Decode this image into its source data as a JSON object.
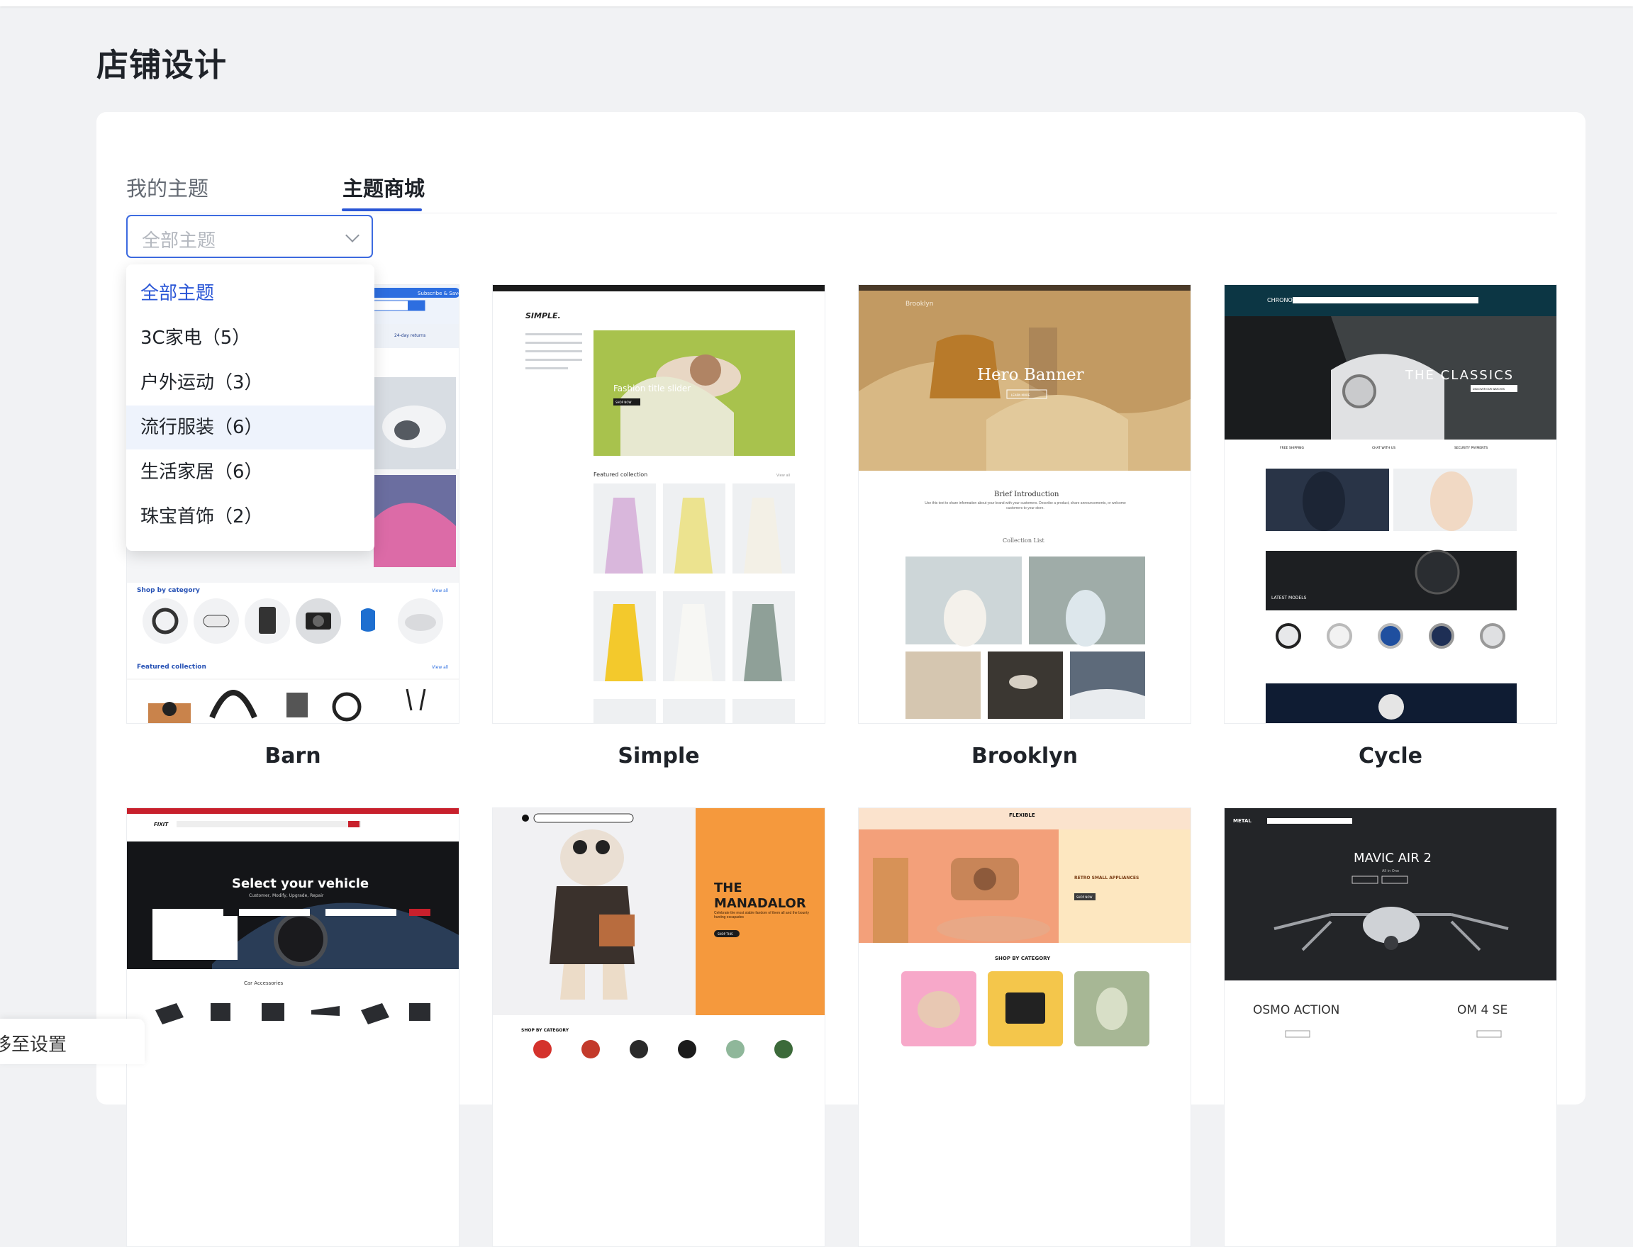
{
  "page": {
    "title": "店铺设计"
  },
  "tabs": [
    {
      "label": "我的主题",
      "active": false
    },
    {
      "label": "主题商城",
      "active": true
    }
  ],
  "filter": {
    "placeholder": "全部主题",
    "options": [
      {
        "label": "全部主题",
        "selected": true
      },
      {
        "label": "3C家电（5）"
      },
      {
        "label": "户外运动（3）"
      },
      {
        "label": "流行服装（6）",
        "hovered": true
      },
      {
        "label": "生活家居（6）"
      },
      {
        "label": "珠宝首饰（2）"
      }
    ]
  },
  "themes": [
    {
      "name": "Barn",
      "preview": {
        "top_texts": [
          "Subscribe & Save",
          "24-day returns"
        ],
        "section_titles": [
          "Shop by category",
          "Featured collection"
        ],
        "links": [
          "View all",
          "View all"
        ]
      }
    },
    {
      "name": "Simple",
      "preview": {
        "logo": "SIMPLE.",
        "hero_text": "Fashion title slider",
        "button": "SHOP NOW",
        "section_title": "Featured collection",
        "link": "View all"
      }
    },
    {
      "name": "Brooklyn",
      "preview": {
        "logo": "Brooklyn",
        "hero_text": "Hero Banner",
        "button": "LEARN MORE",
        "intro_title": "Brief Introduction",
        "intro_body": "Use this text to share information about your brand with your customers. Describe a product, share announcements, or welcome customers to your store.",
        "collection_title": "Collection List"
      }
    },
    {
      "name": "Cycle",
      "preview": {
        "logo": "CHRONO",
        "hero_text": "THE CLASSICS",
        "button": "DISCOVER OUR WATCHES",
        "features": [
          "FREE SHIPPING",
          "CHAT WITH US",
          "SECURITY PAYMENTS"
        ],
        "section_title": "LATEST MODELS"
      }
    },
    {
      "name": "",
      "preview": {
        "logo": "FIXIT",
        "hero_title": "Select your vehicle",
        "hero_sub": "Customer, Modify, Upgrade, Repair",
        "section_title": "Car Accessories"
      }
    },
    {
      "name": "",
      "preview": {
        "hero_title_1": "THE",
        "hero_title_2": "MANADALOR",
        "hero_body": "Celebrate the most stable fandom of them all and the bounty hunting escapades",
        "button": "SHOP THIS",
        "section_title": "SHOP BY CATEGORY"
      }
    },
    {
      "name": "",
      "preview": {
        "logo": "FLEXIBLE",
        "hero_title": "RETRO SMALL APPLIANCES",
        "button": "SHOP NOW",
        "section_title": "SHOP BY CATEGORY"
      }
    },
    {
      "name": "",
      "preview": {
        "logo": "METAL",
        "hero_title": "MAVIC AIR 2",
        "hero_sub": "All in One",
        "products": [
          "OSMO ACTION",
          "OM 4 SE"
        ]
      }
    }
  ],
  "toast": {
    "text": "移至设置"
  },
  "colors": {
    "accent": "#2a56d6",
    "page_bg": "#f1f2f4",
    "card_bg": "#ffffff"
  }
}
